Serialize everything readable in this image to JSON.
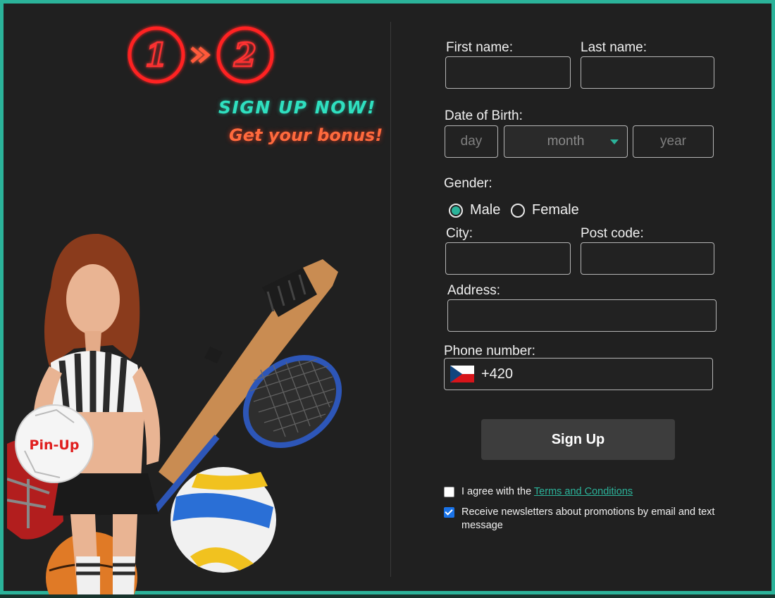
{
  "promo": {
    "step_one": "1",
    "step_two": "2",
    "headline": "SIGN UP NOW!",
    "subheadline": "Get your bonus!",
    "ball_logo": "Pin-Up"
  },
  "form": {
    "first_name": {
      "label": "First name:",
      "value": ""
    },
    "last_name": {
      "label": "Last name:",
      "value": ""
    },
    "dob": {
      "label": "Date of Birth:",
      "day_placeholder": "day",
      "month_selected": "month",
      "year_placeholder": "year"
    },
    "gender": {
      "label": "Gender:",
      "options": [
        "Male",
        "Female"
      ],
      "selected": "Male"
    },
    "city": {
      "label": "City:",
      "value": ""
    },
    "post_code": {
      "label": "Post code:",
      "value": ""
    },
    "address": {
      "label": "Address:",
      "value": ""
    },
    "phone": {
      "label": "Phone number:",
      "country": "CZ",
      "value": "+420"
    },
    "submit_label": "Sign Up",
    "terms": {
      "prefix": "I agree with the ",
      "link": "Terms and Conditions",
      "checked": false
    },
    "newsletter": {
      "text": "Receive newsletters about promotions by email and text message",
      "checked": true
    }
  },
  "colors": {
    "accent": "#2bb39a",
    "background": "#202020",
    "headline": "#2fe0c0",
    "bonus": "#ff6a3d",
    "steps": "#ff2020"
  }
}
